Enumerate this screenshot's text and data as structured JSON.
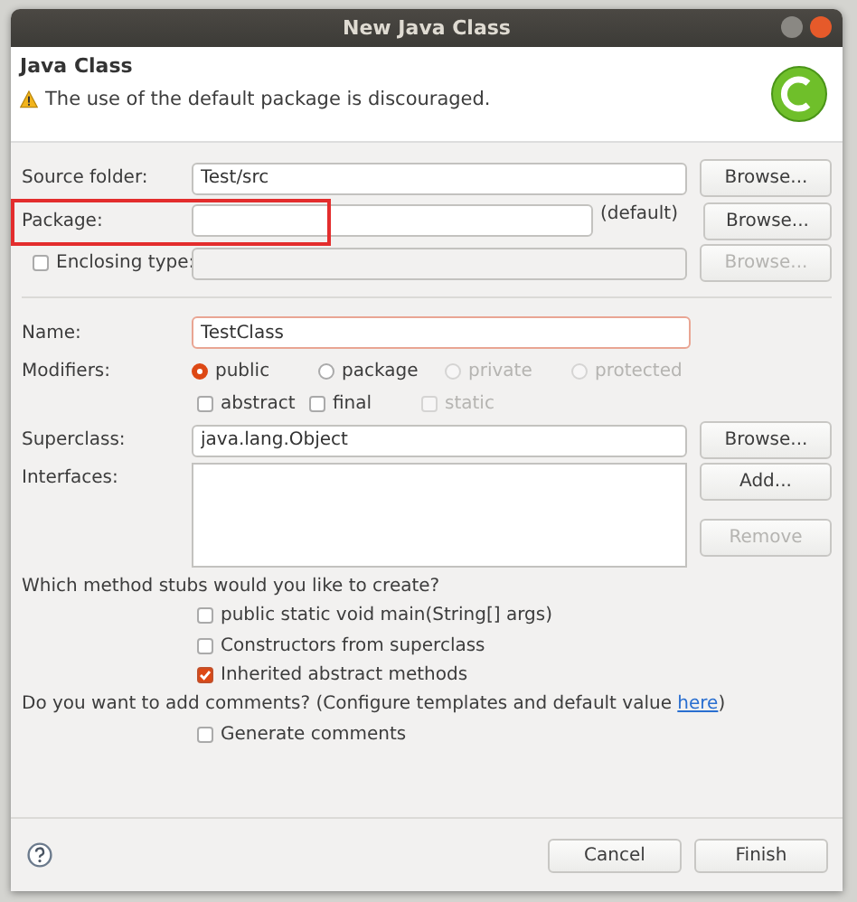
{
  "window": {
    "title": "New Java Class"
  },
  "header": {
    "title": "Java Class",
    "message": "The use of the default package is discouraged."
  },
  "source_folder": {
    "label": "Source folder:",
    "value": "Test/src",
    "button": "Browse..."
  },
  "package": {
    "label": "Package:",
    "suffix": "(default)",
    "button": "Browse...",
    "highlighted": true
  },
  "enclosing_type": {
    "label": "Enclosing type:",
    "checked": false,
    "disabled": true,
    "button": "Browse..."
  },
  "name": {
    "label": "Name:",
    "value": "TestClass"
  },
  "modifiers": {
    "label": "Modifiers:",
    "access": [
      {
        "label": "public",
        "selected": true,
        "disabled": false
      },
      {
        "label": "package",
        "selected": false,
        "disabled": false
      },
      {
        "label": "private",
        "selected": false,
        "disabled": true
      },
      {
        "label": "protected",
        "selected": false,
        "disabled": true
      }
    ],
    "flags": [
      {
        "label": "abstract",
        "checked": false,
        "disabled": false
      },
      {
        "label": "final",
        "checked": false,
        "disabled": false
      },
      {
        "label": "static",
        "checked": false,
        "disabled": true
      }
    ]
  },
  "superclass": {
    "label": "Superclass:",
    "value": "java.lang.Object",
    "button": "Browse..."
  },
  "interfaces": {
    "label": "Interfaces:",
    "buttons": [
      {
        "label": "Add...",
        "disabled": false
      },
      {
        "label": "Remove",
        "disabled": true
      }
    ]
  },
  "method_stubs": {
    "prompt": "Which method stubs would you like to create?",
    "options": [
      {
        "label": "public static void main(String[] args)",
        "checked": false
      },
      {
        "label": "Constructors from superclass",
        "checked": false
      },
      {
        "label": "Inherited abstract methods",
        "checked": true
      }
    ]
  },
  "comments": {
    "prompt_before": "Do you want to add comments? (Configure templates and default value ",
    "link": "here",
    "prompt_after": ")",
    "options": [
      {
        "label": "Generate comments",
        "checked": false
      }
    ]
  },
  "buttons": [
    {
      "label": "Cancel"
    },
    {
      "label": "Finish"
    }
  ]
}
